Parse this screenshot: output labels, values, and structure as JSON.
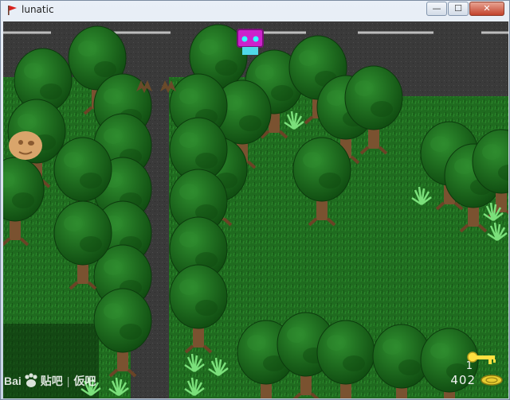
{
  "window": {
    "title": "lunatic",
    "icon": "red-flag-icon",
    "buttons": [
      {
        "name": "minimize-button",
        "glyph": "—"
      },
      {
        "name": "maximize-button",
        "glyph": "☐"
      },
      {
        "name": "close-button",
        "glyph": "✕"
      }
    ]
  },
  "game": {
    "icons": [
      "player-icon",
      "pumpkin-head-icon",
      "bat-icon",
      "tree-icon",
      "grass-tuft-icon",
      "key-icon",
      "coin-icon"
    ]
  },
  "watermark": {
    "brand_left": "Bai",
    "brand_mid": "贴吧",
    "brand_right": "仮吧"
  },
  "hud": {
    "lives": "1",
    "score": "402"
  },
  "colors": {
    "grass": "#1f6b1f",
    "road": "#3d3d3d",
    "foliage": "#1b6a1b",
    "trunk": "#7a5230",
    "player": "#cc22cc",
    "hud_text": "#f2f2f2"
  }
}
